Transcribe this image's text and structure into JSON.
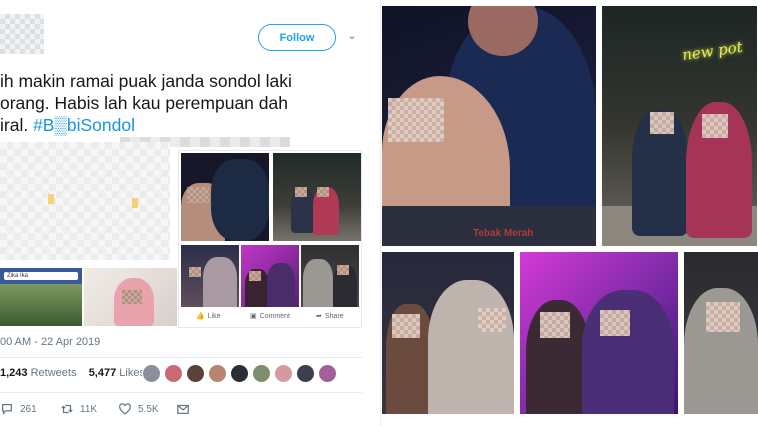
{
  "tweet": {
    "follow_label": "Follow",
    "text_lines": [
      "ih makin ramai puak janda sondol laki",
      "orang. Habis lah kau perempuan dah",
      "iral. "
    ],
    "hashtag": "#B▒biSondol",
    "timestamp": "00 AM - 22 Apr 2019",
    "retweets_count": "1,243",
    "retweets_label": "Retweets",
    "likes_count": "5,477",
    "likes_label": "Likes",
    "reply_count": "261",
    "retweet_action_count": "11K",
    "like_action_count": "5.5K",
    "search_placeholder": "Zika Ika",
    "post_actions": [
      "Like",
      "Comment",
      "Share"
    ]
  },
  "watermark": "Tebak Merah",
  "neon_sign": "new pot",
  "colors": {
    "twitter_blue": "#1da1f2",
    "hashtag_blue": "#1b95e0",
    "muted_gray": "#657786",
    "watermark_red": "#c43d3d"
  }
}
